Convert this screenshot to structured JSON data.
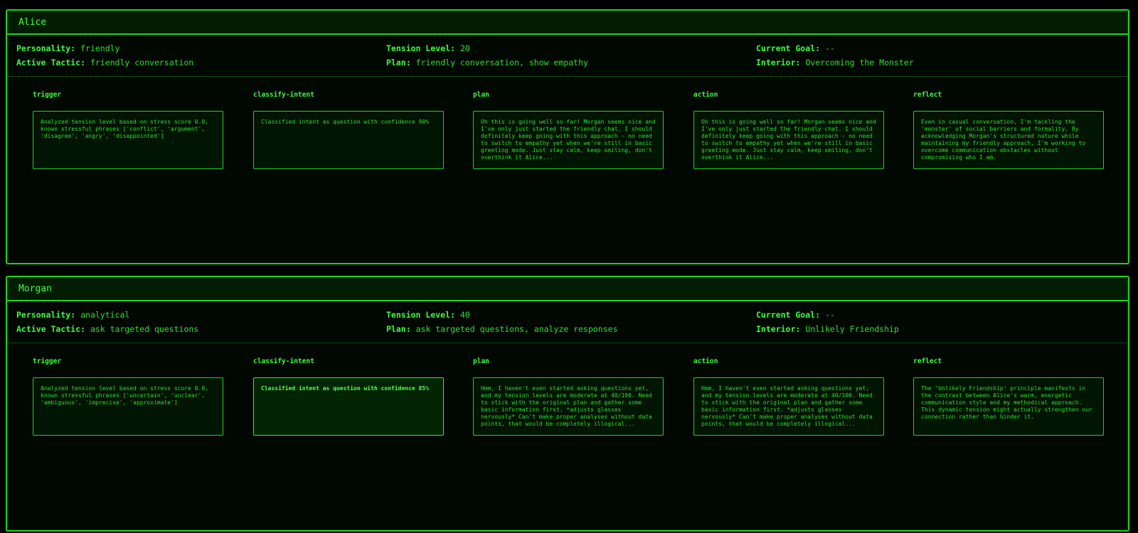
{
  "labels": {
    "personality": "Personality:",
    "tension": "Tension Level:",
    "goal": "Current Goal:",
    "tactic": "Active Tactic:",
    "plan": "Plan:",
    "interior": "Interior:"
  },
  "agents": [
    {
      "name": "Alice",
      "personality": "friendly",
      "tension_level": "20",
      "current_goal": "--",
      "active_tactic": "friendly conversation",
      "plan": "friendly conversation, show empathy",
      "interior": "Overcoming the Monster",
      "steps": [
        {
          "title": "trigger",
          "text": "Analyzed tension level based on stress score 0.0, known stressful phrases ['conflict', 'argument', 'disagree', 'angry', 'disappointed']",
          "active": false
        },
        {
          "title": "classify-intent",
          "text": "Classified intent as question with confidence 90%",
          "active": false
        },
        {
          "title": "plan",
          "text": "Oh this is going well so far! Morgan seems nice and I've only just started the friendly chat. I should definitely keep going with this approach - no need to switch to empathy yet when we're still in basic greeting mode. Just stay calm, keep smiling, don't overthink it Alice...",
          "active": false
        },
        {
          "title": "action",
          "text": "Oh this is going well so far! Morgan seems nice and I've only just started the friendly chat. I should definitely keep going with this approach - no need to switch to empathy yet when we're still in basic greeting mode. Just stay calm, keep smiling, don't overthink it Alice...",
          "active": false
        },
        {
          "title": "reflect",
          "text": "Even in casual conversation, I'm tackling the 'monster' of social barriers and formality. By acknowledging Morgan's structured nature while maintaining my friendly approach, I'm working to overcome communication obstacles without compromising who I am.",
          "active": false
        }
      ]
    },
    {
      "name": "Morgan",
      "personality": "analytical",
      "tension_level": "40",
      "current_goal": "--",
      "active_tactic": "ask targeted questions",
      "plan": "ask targeted questions, analyze responses",
      "interior": "Unlikely Friendship",
      "steps": [
        {
          "title": "trigger",
          "text": "Analyzed tension level based on stress score 0.0, known stressful phrases ['uncertain', 'unclear', 'ambiguous', 'imprecise', 'approximate']",
          "active": false
        },
        {
          "title": "classify-intent",
          "text": "Classified intent as question with confidence 85%",
          "active": true
        },
        {
          "title": "plan",
          "text": "Hmm, I haven't even started asking questions yet, and my tension levels are moderate at 40/100. Need to stick with the original plan and gather some basic information first. *adjusts glasses nervously* Can't make proper analyses without data points, that would be completely illogical...",
          "active": false
        },
        {
          "title": "action",
          "text": "Hmm, I haven't even started asking questions yet, and my tension levels are moderate at 40/100. Need to stick with the original plan and gather some basic information first. *adjusts glasses nervously* Can't make proper analyses without data points, that would be completely illogical...",
          "active": false
        },
        {
          "title": "reflect",
          "text": "The 'Unlikely Friendship' principle manifests in the contrast between Alice's warm, energetic communication style and my methodical approach. This dynamic tension might actually strengthen our connection rather than hinder it.",
          "active": false
        }
      ]
    }
  ]
}
